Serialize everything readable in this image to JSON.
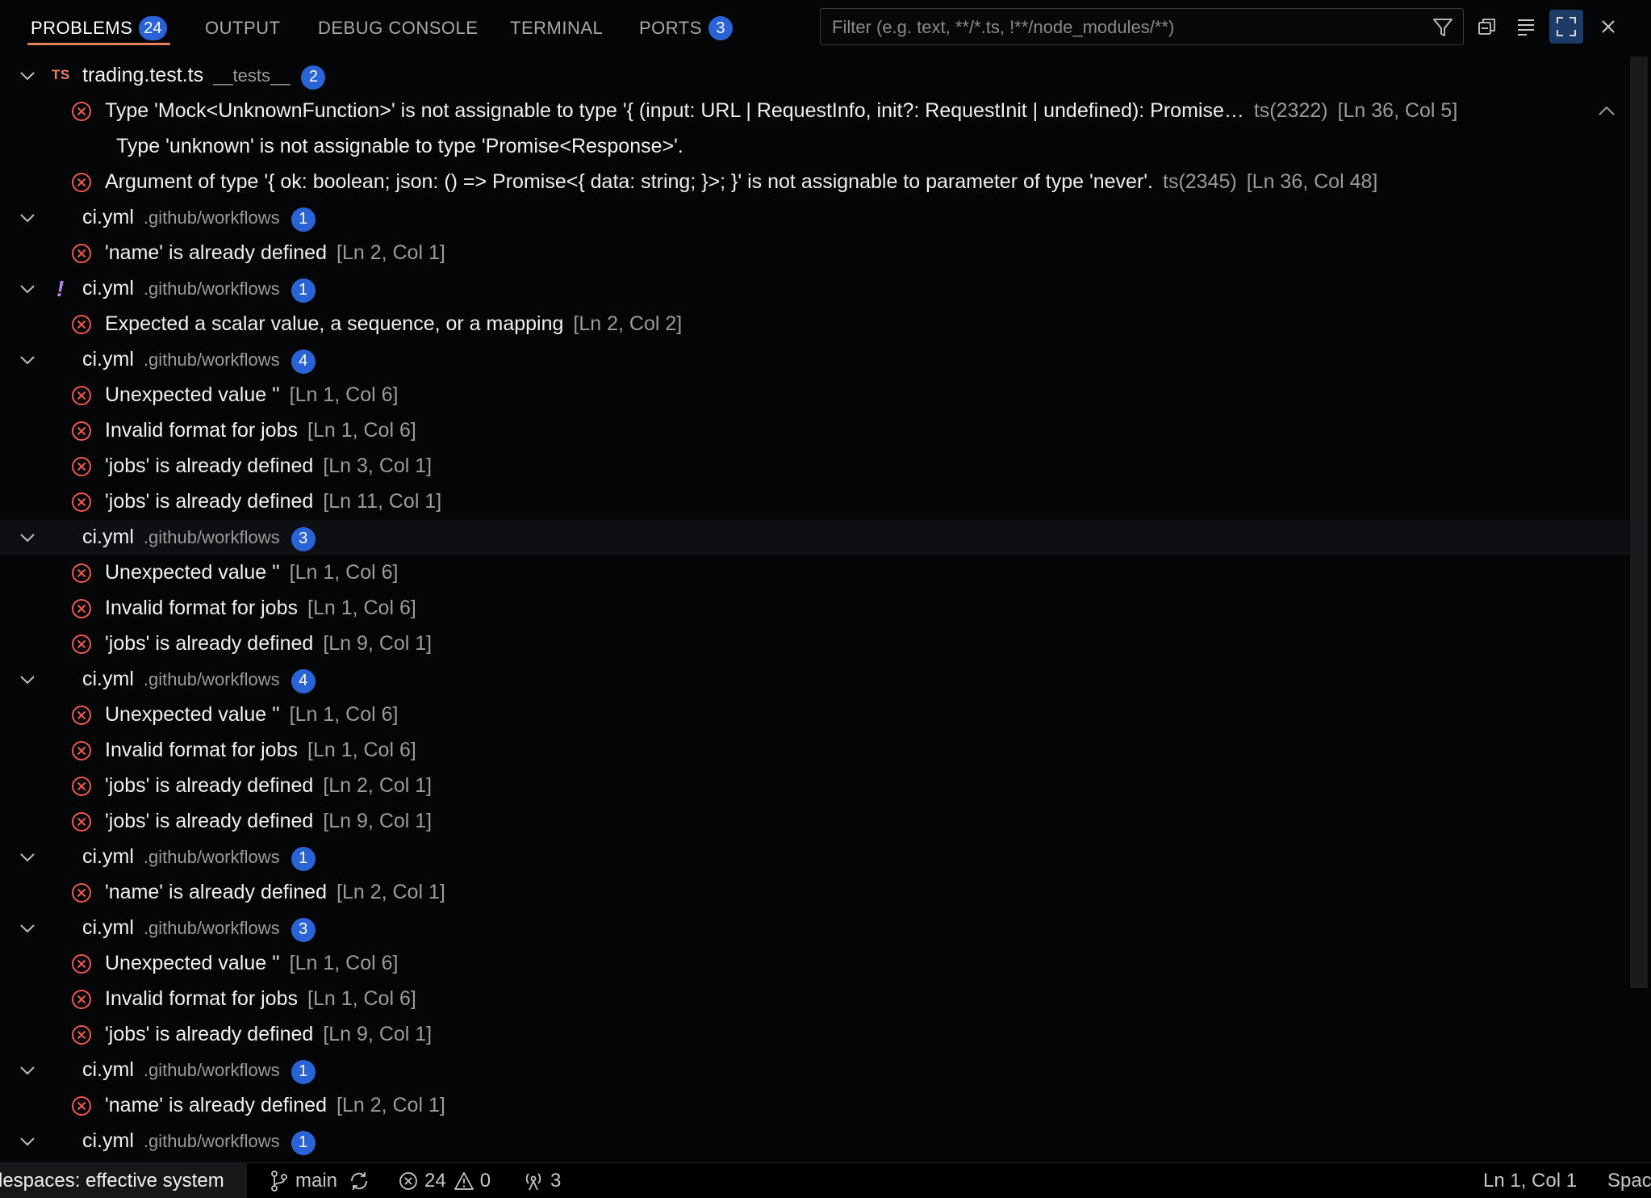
{
  "tabs": [
    {
      "label": "PROBLEMS",
      "badge": "24",
      "active": true
    },
    {
      "label": "OUTPUT"
    },
    {
      "label": "DEBUG CONSOLE"
    },
    {
      "label": "TERMINAL"
    },
    {
      "label": "PORTS",
      "badge": "3"
    }
  ],
  "filter": {
    "placeholder": "Filter (e.g. text, **/*.ts, !**/node_modules/**)"
  },
  "files": [
    {
      "name": "trading.test.ts",
      "path": "__tests__",
      "count": "2",
      "type": "TS",
      "problems": [
        {
          "message": "Type 'Mock<UnknownFunction>' is not assignable to type '{ (input: URL | RequestInfo, init?: RequestInit | undefined): Promise…",
          "code": "ts(2322)",
          "loc": "[Ln 36, Col 5]",
          "detail": "Type 'unknown' is not assignable to type 'Promise<Response>'."
        },
        {
          "message": "Argument of type '{ ok: boolean; json: () => Promise<{ data: string; }>; }' is not assignable to parameter of type 'never'.",
          "code": "ts(2345)",
          "loc": "[Ln 36, Col 48]"
        }
      ]
    },
    {
      "name": "ci.yml",
      "path": ".github/workflows",
      "count": "1",
      "problems": [
        {
          "message": "'name' is already defined",
          "loc": "[Ln 2, Col 1]"
        }
      ]
    },
    {
      "name": "ci.yml",
      "path": ".github/workflows",
      "count": "1",
      "type": "!",
      "problems": [
        {
          "message": "Expected a scalar value, a sequence, or a mapping",
          "loc": "[Ln 2, Col 2]"
        }
      ]
    },
    {
      "name": "ci.yml",
      "path": ".github/workflows",
      "count": "4",
      "problems": [
        {
          "message": "Unexpected value ''",
          "loc": "[Ln 1, Col 6]"
        },
        {
          "message": "Invalid format for jobs",
          "loc": "[Ln 1, Col 6]"
        },
        {
          "message": "'jobs' is already defined",
          "loc": "[Ln 3, Col 1]"
        },
        {
          "message": "'jobs' is already defined",
          "loc": "[Ln 11, Col 1]"
        }
      ]
    },
    {
      "name": "ci.yml",
      "path": ".github/workflows",
      "count": "3",
      "highlight": true,
      "problems": [
        {
          "message": "Unexpected value ''",
          "loc": "[Ln 1, Col 6]"
        },
        {
          "message": "Invalid format for jobs",
          "loc": "[Ln 1, Col 6]"
        },
        {
          "message": "'jobs' is already defined",
          "loc": "[Ln 9, Col 1]"
        }
      ]
    },
    {
      "name": "ci.yml",
      "path": ".github/workflows",
      "count": "4",
      "problems": [
        {
          "message": "Unexpected value ''",
          "loc": "[Ln 1, Col 6]"
        },
        {
          "message": "Invalid format for jobs",
          "loc": "[Ln 1, Col 6]"
        },
        {
          "message": "'jobs' is already defined",
          "loc": "[Ln 2, Col 1]"
        },
        {
          "message": "'jobs' is already defined",
          "loc": "[Ln 9, Col 1]"
        }
      ]
    },
    {
      "name": "ci.yml",
      "path": ".github/workflows",
      "count": "1",
      "problems": [
        {
          "message": "'name' is already defined",
          "loc": "[Ln 2, Col 1]"
        }
      ]
    },
    {
      "name": "ci.yml",
      "path": ".github/workflows",
      "count": "3",
      "problems": [
        {
          "message": "Unexpected value ''",
          "loc": "[Ln 1, Col 6]"
        },
        {
          "message": "Invalid format for jobs",
          "loc": "[Ln 1, Col 6]"
        },
        {
          "message": "'jobs' is already defined",
          "loc": "[Ln 9, Col 1]"
        }
      ]
    },
    {
      "name": "ci.yml",
      "path": ".github/workflows",
      "count": "1",
      "problems": [
        {
          "message": "'name' is already defined",
          "loc": "[Ln 2, Col 1]"
        }
      ]
    },
    {
      "name": "ci.yml",
      "path": ".github/workflows",
      "count": "1",
      "problems": []
    }
  ],
  "status": {
    "remote": "lespaces: effective system",
    "branch": "main",
    "errors": "24",
    "warnings": "0",
    "ports": "3",
    "position": "Ln 1, Col 1",
    "spaces": "Spac"
  },
  "colors": {
    "accent_tab": "#e8825b",
    "badge": "#2a63d6",
    "error": "#f0584f",
    "warning": "#b884f0"
  }
}
